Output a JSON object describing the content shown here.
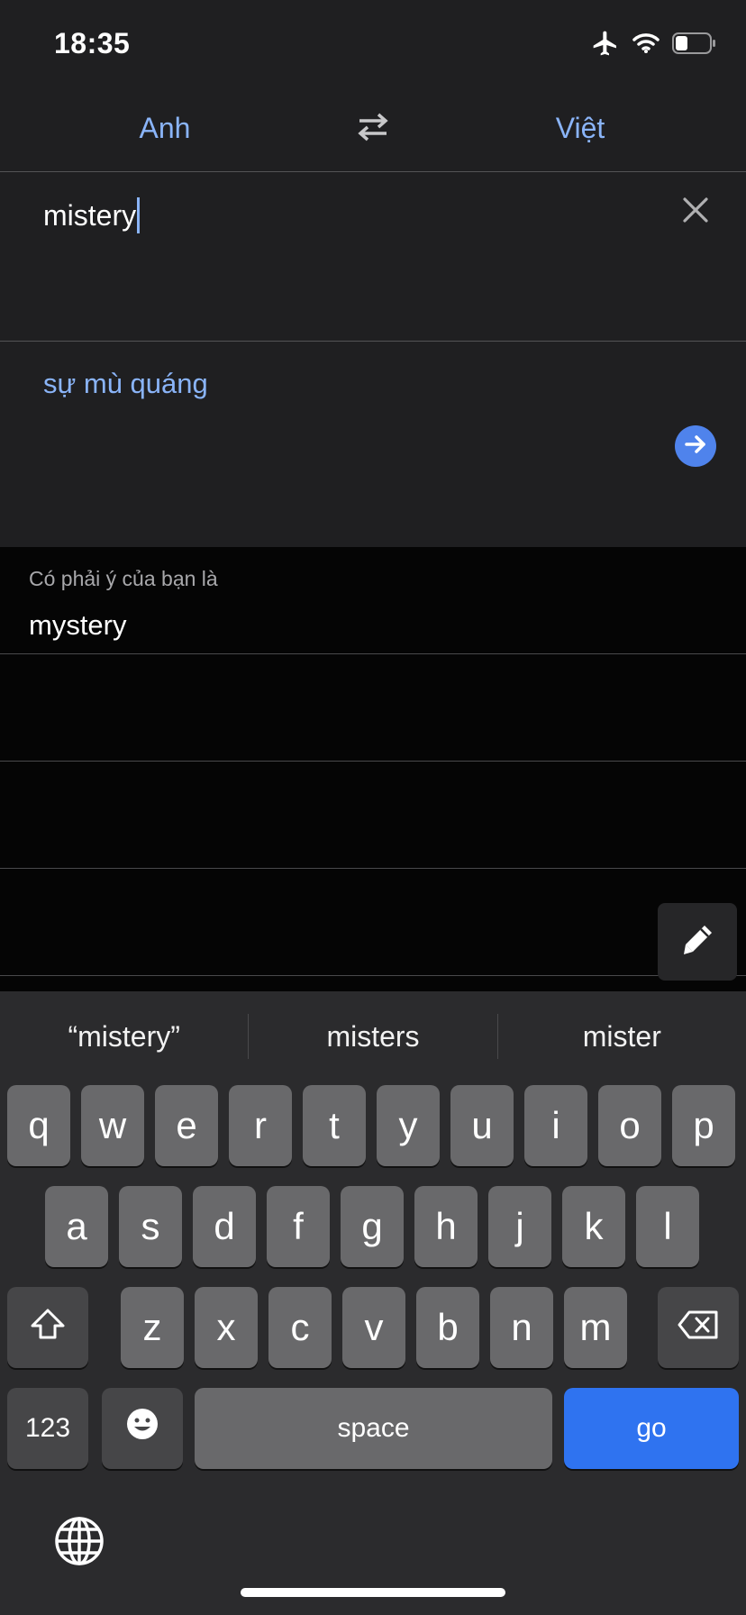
{
  "status_bar": {
    "time": "18:35",
    "icons": [
      "airplane-icon",
      "wifi-icon",
      "battery-icon"
    ],
    "battery_level": 0.35
  },
  "languages": {
    "source": "Anh",
    "target": "Việt"
  },
  "input": {
    "value": "mistery"
  },
  "result": {
    "translation": "sự mù quáng"
  },
  "suggestion": {
    "label": "Có phải ý của bạn là",
    "word": "mystery"
  },
  "keyboard": {
    "predictions": [
      "“mistery”",
      "misters",
      "mister"
    ],
    "row1": [
      "q",
      "w",
      "e",
      "r",
      "t",
      "y",
      "u",
      "i",
      "o",
      "p"
    ],
    "row2": [
      "a",
      "s",
      "d",
      "f",
      "g",
      "h",
      "j",
      "k",
      "l"
    ],
    "row3": [
      "z",
      "x",
      "c",
      "v",
      "b",
      "n",
      "m"
    ],
    "numbers_label": "123",
    "space_label": "space",
    "go_label": "go"
  },
  "colors": {
    "accent": "#8ab4f8",
    "go_key": "#2f73f0",
    "panel": "#1f1f21"
  }
}
